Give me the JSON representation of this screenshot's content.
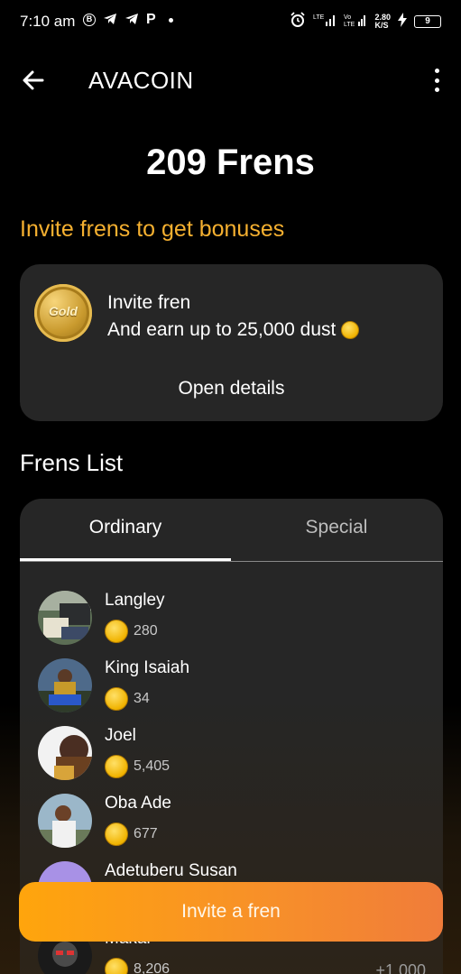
{
  "status_bar": {
    "time": "7:10 am",
    "network_speed": "2.80",
    "speed_unit": "K/S",
    "battery": "9"
  },
  "app_bar": {
    "title": "AVACOIN"
  },
  "frens_count": "209 Frens",
  "invite_heading": "Invite frens to get bonuses",
  "invite_card": {
    "badge_text": "Gold",
    "line1": "Invite fren",
    "line2": "And earn up to 25,000 dust",
    "details_label": "Open details"
  },
  "frens_list_title": "Frens List",
  "tabs": [
    {
      "label": "Ordinary",
      "active": true
    },
    {
      "label": "Special",
      "active": false
    }
  ],
  "frens": [
    {
      "name": "Langley",
      "score": "280"
    },
    {
      "name": "King Isaiah",
      "score": "34"
    },
    {
      "name": "Joel",
      "score": "5,405"
    },
    {
      "name": "Oba Ade",
      "score": "677"
    },
    {
      "name": "Adetuberu Susan",
      "score": ""
    },
    {
      "name": "Makai",
      "score": "8,206",
      "bonus": "+1,000"
    }
  ],
  "invite_button_label": "Invite a fren",
  "colors": {
    "accent": "#f5b030",
    "card_bg": "#262626",
    "button_start": "#ffa50c",
    "button_end": "#f07c3a"
  }
}
